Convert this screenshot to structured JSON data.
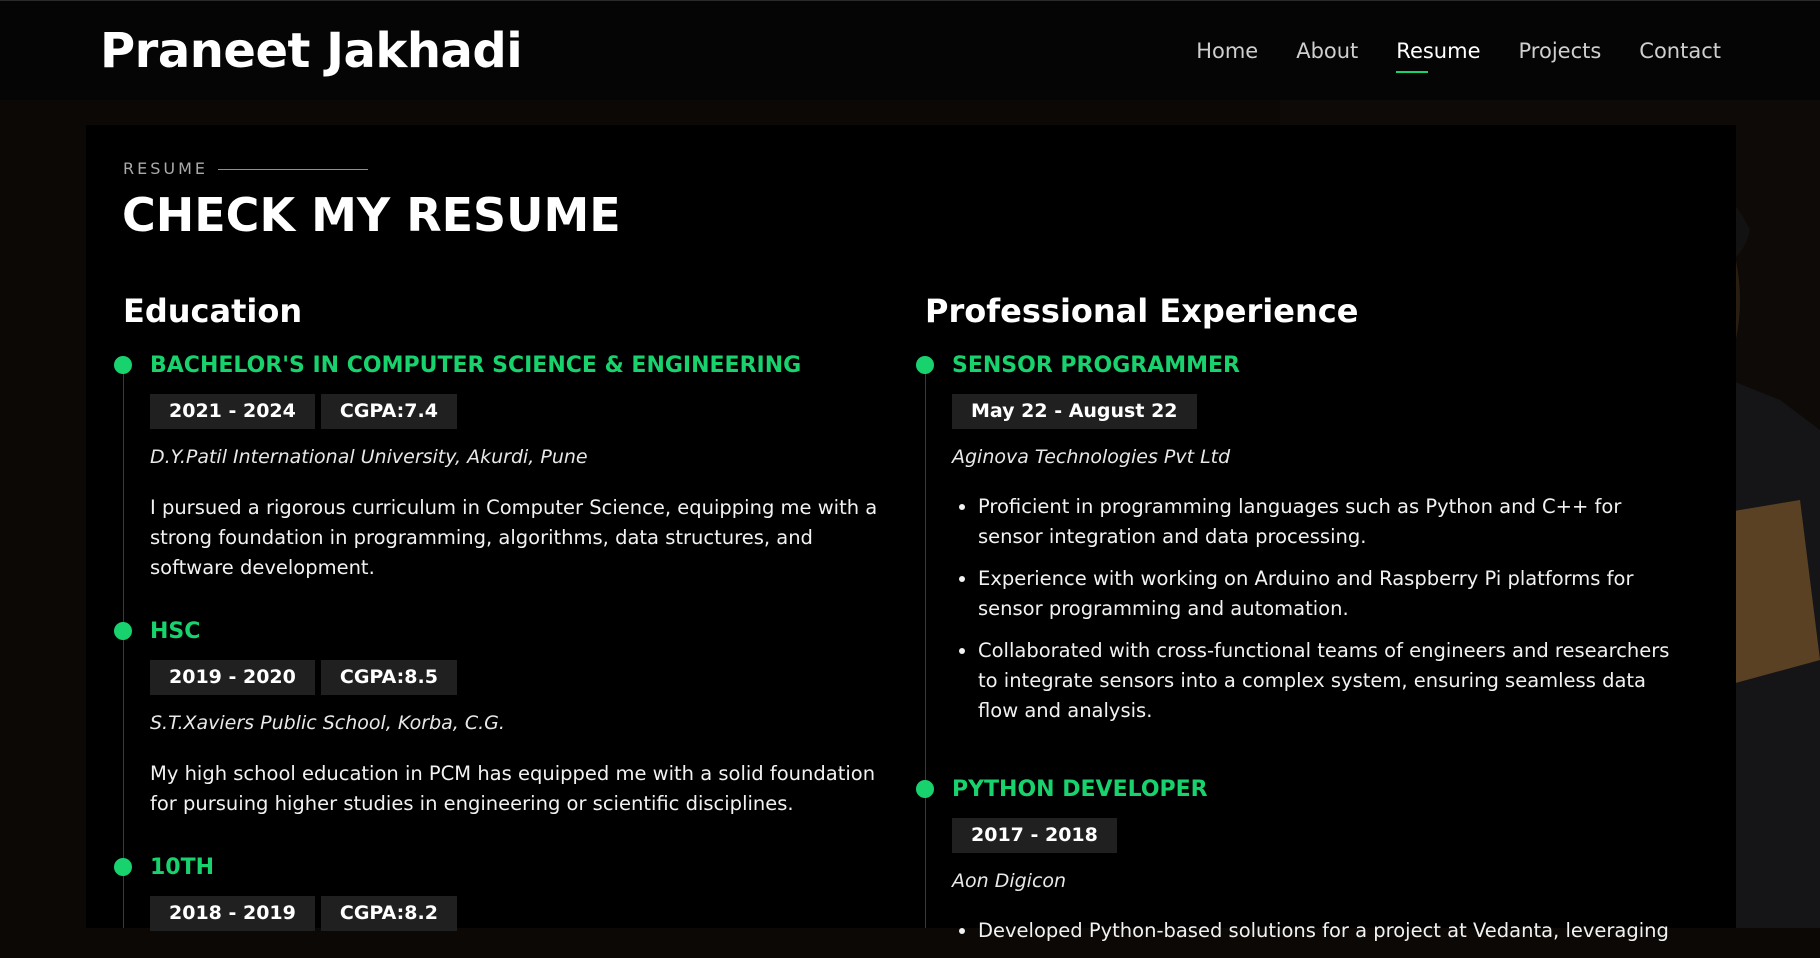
{
  "artifact": "-> -->",
  "site": {
    "name": "Praneet Jakhadi"
  },
  "nav": [
    {
      "label": "Home"
    },
    {
      "label": "About"
    },
    {
      "label": "Resume",
      "active": true
    },
    {
      "label": "Projects"
    },
    {
      "label": "Contact"
    }
  ],
  "section": {
    "label": "RESUME",
    "title": "CHECK MY RESUME"
  },
  "education": {
    "heading": "Education",
    "items": [
      {
        "title": "BACHELOR'S IN COMPUTER SCIENCE & ENGINEERING",
        "period": "2021 - 2024",
        "grade": "CGPA:7.4",
        "org": "D.Y.Patil International University, Akurdi, Pune",
        "desc": "I pursued a rigorous curriculum in Computer Science, equipping me with a strong foundation in programming, algorithms, data structures, and software development."
      },
      {
        "title": "HSC",
        "period": "2019 - 2020",
        "grade": "CGPA:8.5",
        "org": "S.T.Xaviers Public School, Korba, C.G.",
        "desc": "My high school education in PCM has equipped me with a solid foundation for pursuing higher studies in engineering or scientific disciplines."
      },
      {
        "title": "10TH",
        "period": "2018 - 2019",
        "grade": "CGPA:8.2"
      }
    ]
  },
  "experience": {
    "heading": "Professional Experience",
    "items": [
      {
        "title": "SENSOR PROGRAMMER",
        "period": "May 22 - August 22",
        "org": "Aginova Technologies Pvt Ltd",
        "bullets": [
          "Proficient in programming languages such as Python and C++ for sensor integration and data processing.",
          "Experience with working on Arduino and Raspberry Pi platforms for sensor programming and automation.",
          "Collaborated with cross-functional teams of engineers and researchers to integrate sensors into a complex system, ensuring seamless data flow and analysis."
        ]
      },
      {
        "title": "PYTHON DEVELOPER",
        "period": "2017 - 2018",
        "org": "Aon Digicon",
        "bullets": [
          "Developed Python-based solutions for a project at Vedanta, leveraging"
        ]
      }
    ]
  },
  "colors": {
    "accent": "#18d26e",
    "background": "#000000",
    "badge": "#202020"
  }
}
